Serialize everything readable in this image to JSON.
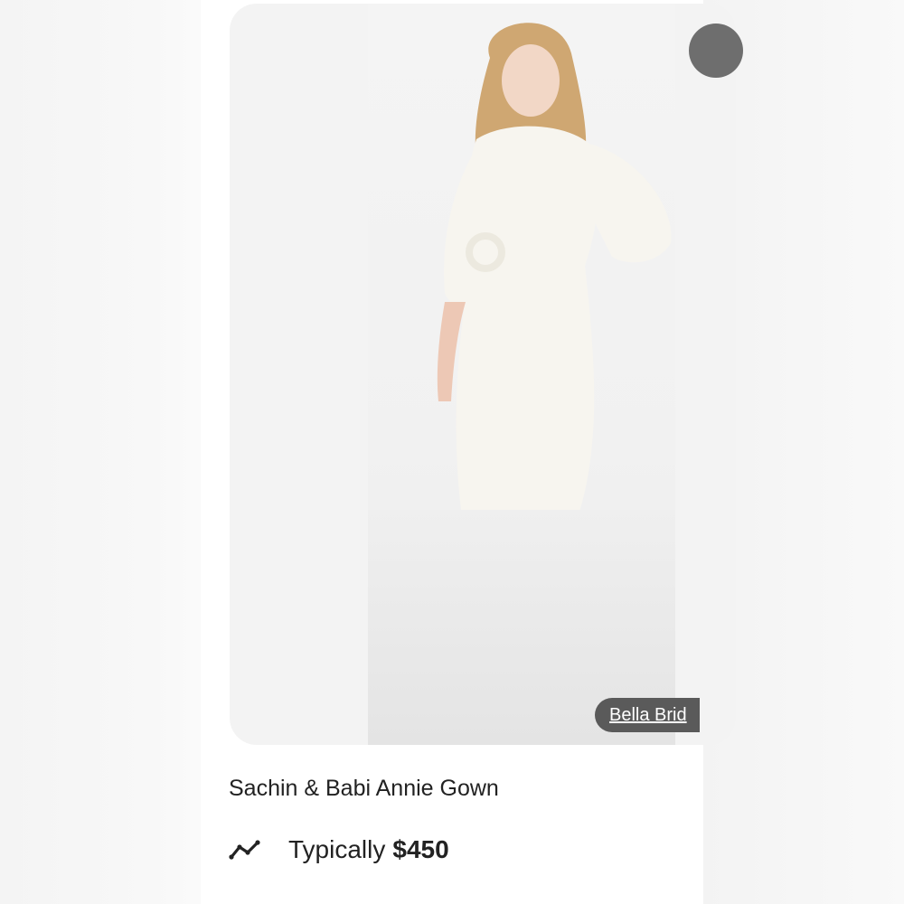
{
  "product": {
    "title": "Sachin & Babi Annie Gown",
    "seller_label": "Bella Brid",
    "price_prefix": "Typically",
    "price_value": "$450",
    "trend_icon": "trend-line-icon"
  },
  "colors": {
    "chip_bg": "#5a5a5a",
    "image_bg": "#f3f3f3",
    "text": "#222222"
  }
}
